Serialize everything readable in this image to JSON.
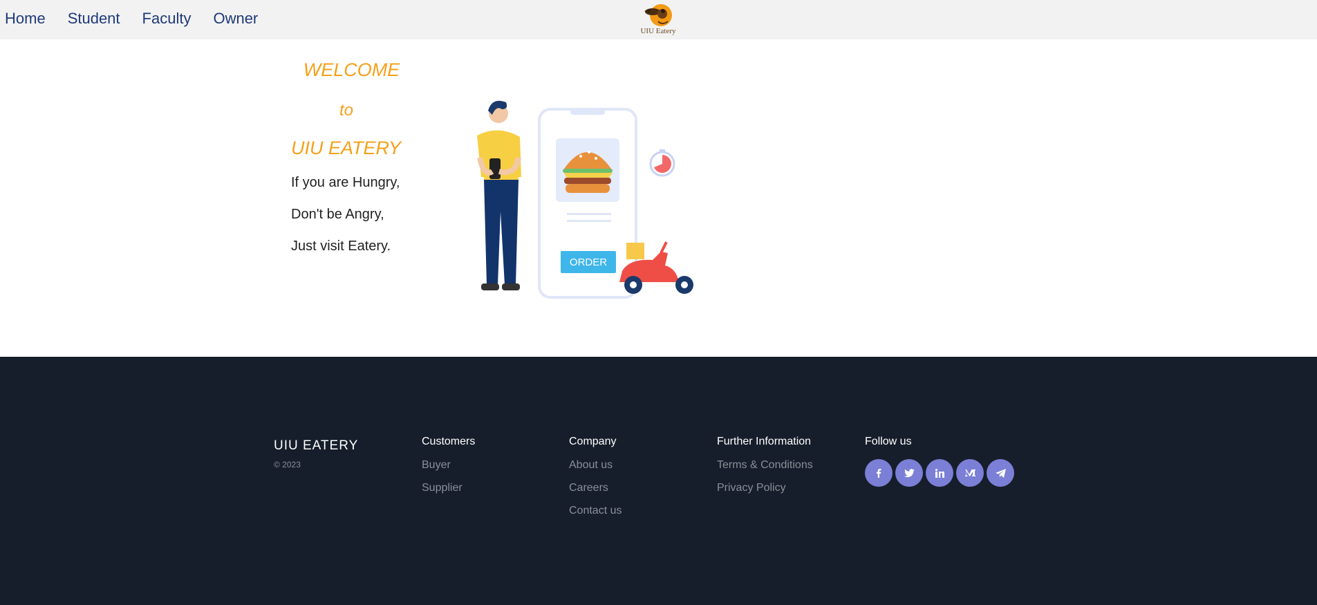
{
  "nav": {
    "links": [
      "Home",
      "Student",
      "Faculty",
      "Owner"
    ],
    "logo_text": "UIU Eatery"
  },
  "hero": {
    "welcome": "WELCOME",
    "to": "to",
    "brand": "UIU EATERY",
    "lines": [
      "If you are Hungry,",
      "Don't be Angry,",
      "Just visit Eatery."
    ],
    "order_label": "ORDER"
  },
  "footer": {
    "brand": "UIU EATERY",
    "copyright": "© 2023",
    "columns": [
      {
        "title": "Customers",
        "links": [
          "Buyer",
          "Supplier"
        ]
      },
      {
        "title": "Company",
        "links": [
          "About us",
          "Careers",
          "Contact us"
        ]
      },
      {
        "title": "Further Information",
        "links": [
          "Terms & Conditions",
          "Privacy Policy"
        ]
      }
    ],
    "follow_title": "Follow us",
    "socials": [
      "facebook-icon",
      "twitter-icon",
      "linkedin-icon",
      "medium-icon",
      "telegram-icon"
    ]
  },
  "colors": {
    "accent": "#f5a01a",
    "nav_text": "#1e3a7a",
    "footer_bg": "#161e2b",
    "social_bg": "#7b7fd6"
  }
}
